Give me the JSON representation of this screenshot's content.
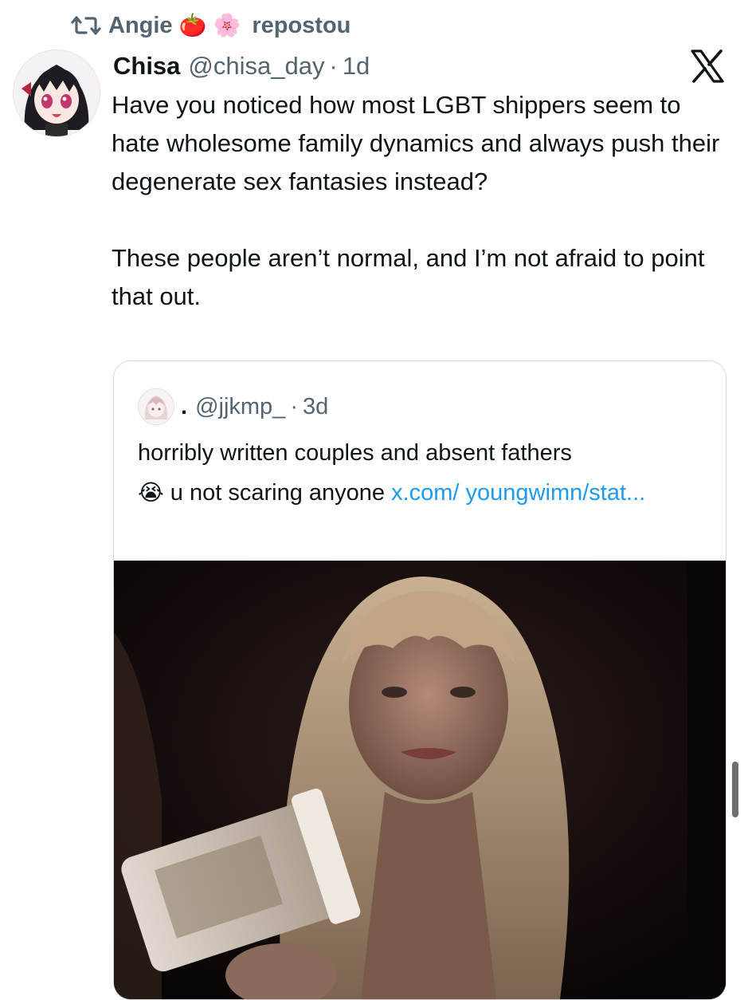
{
  "repost": {
    "icon": "repost-icon",
    "name": "Angie",
    "emojis": [
      "🍅",
      "🌸"
    ],
    "verb": "repostou"
  },
  "post": {
    "display_name": "Chisa",
    "handle": "@chisa_day",
    "separator": "·",
    "time": "1d",
    "paragraph1": "Have you noticed how most LGBT shippers seem to hate wholesome family dynamics and always push their degenerate sex fantasies instead?",
    "paragraph2": "These people aren’t normal, and I’m not afraid to point that out.",
    "avatar_icon": "anime-avatar"
  },
  "brand": {
    "logo": "x-logo-icon"
  },
  "quote": {
    "display_name": ".",
    "handle": "@jjkmp_",
    "separator": "·",
    "time": "3d",
    "text_line1": "horribly written couples and absent fathers",
    "emoji": "😭",
    "text_line2": "u not scaring anyone",
    "link": "x.com/ youngwimn/stat...",
    "media": "photo-woman-with-cup"
  },
  "colors": {
    "text": "#0f1419",
    "secondary": "#536471",
    "link": "#1d9bf0",
    "border": "#cfd9de"
  }
}
